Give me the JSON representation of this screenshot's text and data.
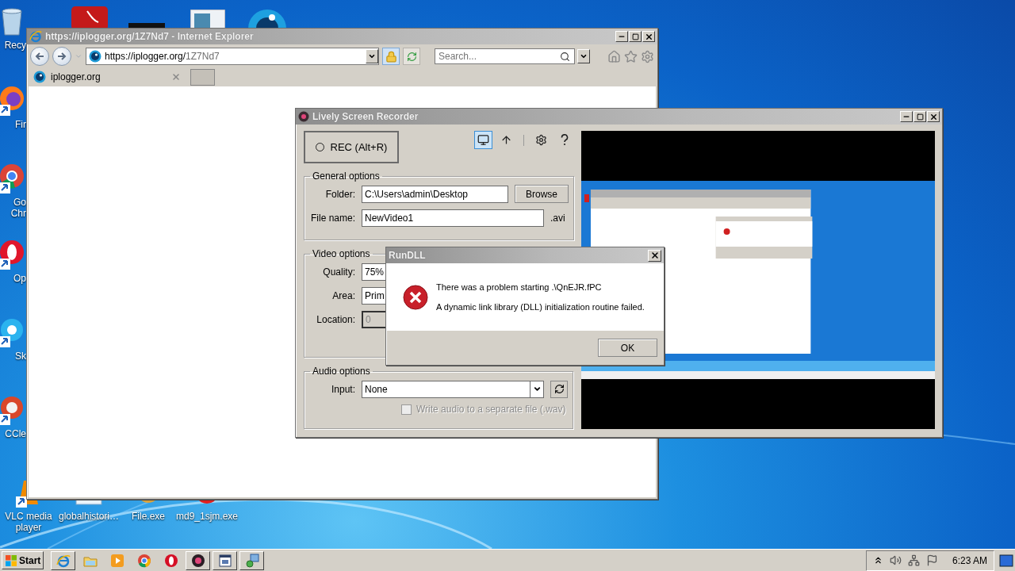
{
  "desktop": {
    "icons": [
      {
        "kind": "recycle",
        "lines": [
          "Recy"
        ]
      },
      {
        "kind": "firefox",
        "lines": [
          "Fir"
        ]
      },
      {
        "kind": "chrome",
        "lines": [
          "Go",
          "Chr"
        ]
      },
      {
        "kind": "opera",
        "lines": [
          "Op"
        ]
      },
      {
        "kind": "skype",
        "lines": [
          "Sk"
        ]
      },
      {
        "kind": "ccleaner",
        "lines": [
          "CCle"
        ]
      },
      {
        "kind": "vlc",
        "lines": [
          "VLC media",
          "player"
        ]
      },
      {
        "kind": "folder",
        "lines": [
          "globalhistori…"
        ]
      },
      {
        "kind": "exe",
        "lines": [
          "File.exe"
        ]
      },
      {
        "kind": "disc",
        "lines": [
          "md9_1sjm.exe"
        ]
      }
    ]
  },
  "browser": {
    "title": "https://iplogger.org/1Z7Nd7 - Internet Explorer",
    "address": {
      "host": "https://iplogger.org/",
      "path": "1Z7Nd7"
    },
    "search": {
      "placeholder": "Search..."
    },
    "tabs": [
      {
        "label": "iplogger.org",
        "selected": true
      }
    ]
  },
  "recorder": {
    "title": "Lively Screen Recorder",
    "record_button": "REC (Alt+R)",
    "toolbar": [
      {
        "kind": "screen",
        "selected": true
      },
      {
        "kind": "upload",
        "selected": false
      },
      {
        "kind": "settings",
        "selected": false
      },
      {
        "kind": "help",
        "selected": false
      }
    ],
    "general": {
      "legend": "General options",
      "folder": {
        "label": "Folder:",
        "value": "C:\\Users\\admin\\Desktop"
      },
      "browse": "Browse",
      "file_name": {
        "label": "File name:",
        "value": "NewVideo1",
        "suffix": ".avi"
      }
    },
    "video": {
      "legend": "Video options",
      "quality": {
        "label": "Quality:",
        "value": "75%"
      },
      "area": {
        "label": "Area:",
        "value": "Prim"
      },
      "location": {
        "label": "Location:",
        "value": "0",
        "disabled": true
      }
    },
    "audio": {
      "legend": "Audio options",
      "input": {
        "label": "Input:",
        "value": "None"
      },
      "separate_file": {
        "label": "Write audio to a separate file (.wav)",
        "checked": false,
        "disabled": true
      }
    }
  },
  "dialog": {
    "title": "RunDLL",
    "lines": [
      "There was a problem starting .\\QnEJR.fPC",
      "A dynamic link library (DLL) initialization routine failed."
    ],
    "ok": "OK"
  },
  "taskbar": {
    "start": "Start",
    "apps": [
      {
        "kind": "ie",
        "running": true
      },
      {
        "kind": "explorer",
        "running": false
      },
      {
        "kind": "media",
        "running": false
      },
      {
        "kind": "chrome",
        "running": false
      },
      {
        "kind": "opera",
        "running": false
      },
      {
        "kind": "recorder",
        "running": true
      },
      {
        "kind": "window",
        "running": true
      },
      {
        "kind": "network",
        "running": true
      }
    ],
    "clock": "6:23 AM"
  }
}
